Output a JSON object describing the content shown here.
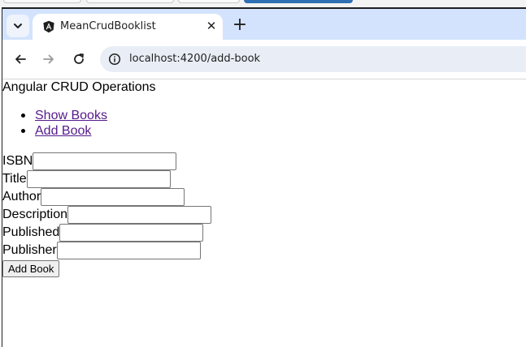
{
  "browser": {
    "tab": {
      "title": "MeanCrudBooklist",
      "favicon": "angular-logo-icon"
    },
    "address_bar": {
      "url": "localhost:4200/add-book"
    },
    "icons": {
      "tab_search": "chevron-down-icon",
      "close": "close-icon",
      "new_tab": "plus-icon",
      "back": "back-arrow-icon",
      "forward": "forward-arrow-icon",
      "reload": "reload-icon",
      "site_info": "info-icon"
    }
  },
  "page": {
    "title": "Angular CRUD Operations",
    "nav": [
      {
        "label": "Show Books"
      },
      {
        "label": "Add Book"
      }
    ],
    "form": {
      "fields": [
        {
          "label": "ISBN",
          "value": ""
        },
        {
          "label": "Title",
          "value": ""
        },
        {
          "label": "Author",
          "value": ""
        },
        {
          "label": "Description",
          "value": ""
        },
        {
          "label": "Published",
          "value": ""
        },
        {
          "label": "Publisher",
          "value": ""
        }
      ],
      "submit_label": "Add Book"
    }
  },
  "colors": {
    "tab_strip": "#d3e3fd",
    "omnibox": "#e9eef6",
    "visited_link": "#551a8b"
  }
}
